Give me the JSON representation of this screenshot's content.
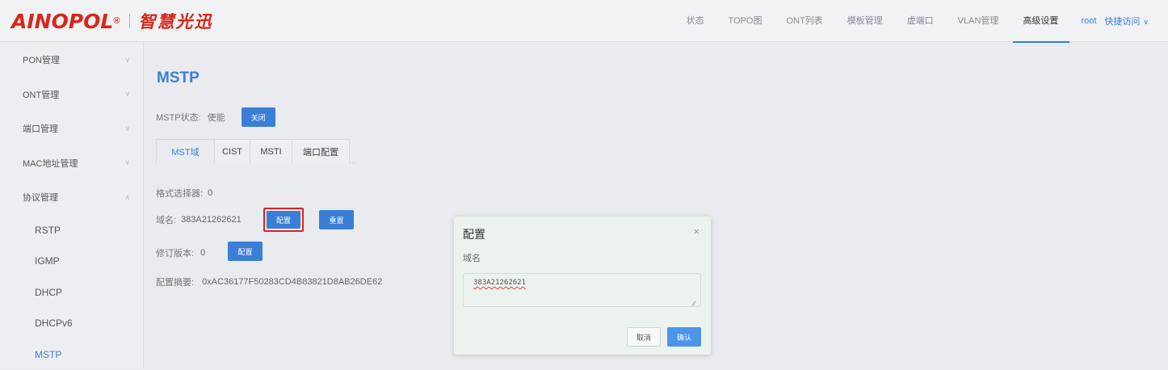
{
  "brand": {
    "name": "AINOPOL",
    "reg": "®",
    "cn": "智慧光迅"
  },
  "topnav": {
    "items": [
      "状态",
      "TOPO图",
      "ONT列表",
      "模板管理",
      "虚端口",
      "VLAN管理",
      "高级设置"
    ],
    "active_index": 6,
    "user": "root",
    "quick": "快捷访问"
  },
  "sidebar": {
    "menus": [
      {
        "label": "PON管理",
        "expanded": false
      },
      {
        "label": "ONT管理",
        "expanded": false
      },
      {
        "label": "端口管理",
        "expanded": false
      },
      {
        "label": "MAC地址管理",
        "expanded": false
      },
      {
        "label": "协议管理",
        "expanded": true
      }
    ],
    "subitems": [
      "RSTP",
      "IGMP",
      "DHCP",
      "DHCPv6",
      "MSTP"
    ],
    "active_sub": "MSTP"
  },
  "main": {
    "title": "MSTP",
    "status_label": "MSTP状态:",
    "status_value": "使能",
    "close_button": "关闭",
    "tabs": [
      "MST域",
      "CIST",
      "MSTI",
      "端口配置"
    ],
    "active_tab": 0,
    "format_selector_label": "格式选择器:",
    "format_selector_value": "0",
    "domain_label": "域名:",
    "domain_value": "383A21262621",
    "config_button": "配置",
    "reset_button": "重置",
    "revision_label": "修订版本:",
    "revision_value": "0",
    "revision_config_button": "配置",
    "digest_label": "配置摘要:",
    "digest_value": "0xAC36177F50283CD4B83821D8AB26DE62"
  },
  "dialog": {
    "title": "配置",
    "close": "×",
    "field_label": "域名",
    "field_value": "383A21262621",
    "cancel": "取消",
    "ok": "确认"
  },
  "colors": {
    "accent": "#3a7fd5",
    "brand": "#d9261c",
    "highlight": "#e02020"
  }
}
